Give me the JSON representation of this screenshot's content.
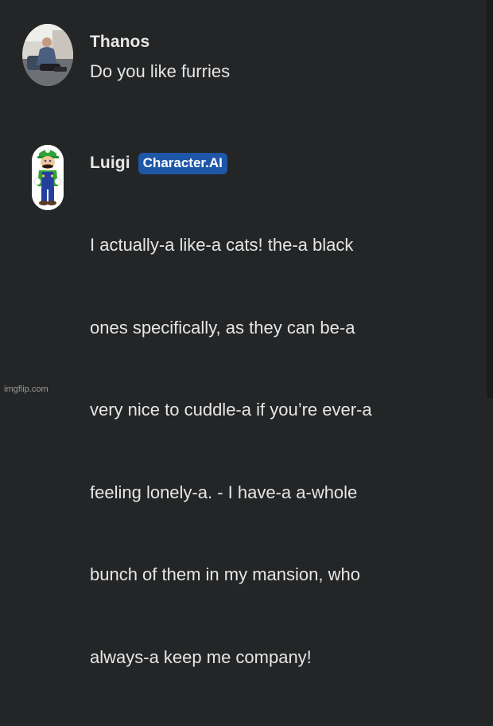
{
  "messages": [
    {
      "author": "Thanos",
      "text": "Do you like furries",
      "avatar_icon": "user-photo-avatar"
    },
    {
      "author": "Luigi",
      "badge": "Character.AI",
      "lines": [
        "I actually-a like-a cats! the-a black",
        "ones specifically, as they can be-a",
        "very nice to cuddle-a if you’re ever-a",
        "feeling lonely-a. - I have-a a-whole",
        "bunch of them in my mansion, who",
        "always-a keep me company!"
      ],
      "avatar_icon": "luigi-character-avatar"
    }
  ],
  "watermark": "imgflip.com",
  "colors": {
    "background": "#242526",
    "badge": "#1e56a8",
    "text": "#e6e6e6"
  }
}
